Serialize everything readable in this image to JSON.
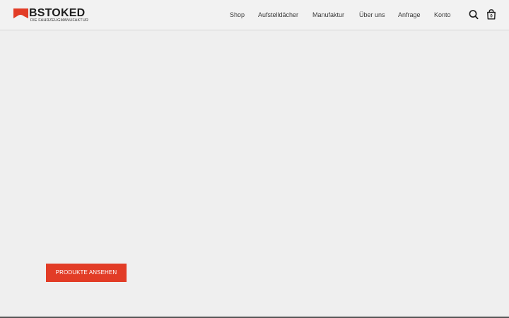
{
  "brand": {
    "name": "BSTOKED",
    "tagline": "DIE FAHRZEUGMANUFAKTUR",
    "accent_color": "#e23c26"
  },
  "nav": {
    "shop": "Shop",
    "roofs": "Aufstelldächer",
    "manufaktur": "Manufaktur",
    "about": "Über uns",
    "request": "Anfrage",
    "account": "Konto"
  },
  "icons": {
    "search": "search-icon",
    "cart": "shopping-bag-icon"
  },
  "cart": {
    "count": "0"
  },
  "hero": {
    "cta_label": "PRODUKTE ANSEHEN"
  }
}
